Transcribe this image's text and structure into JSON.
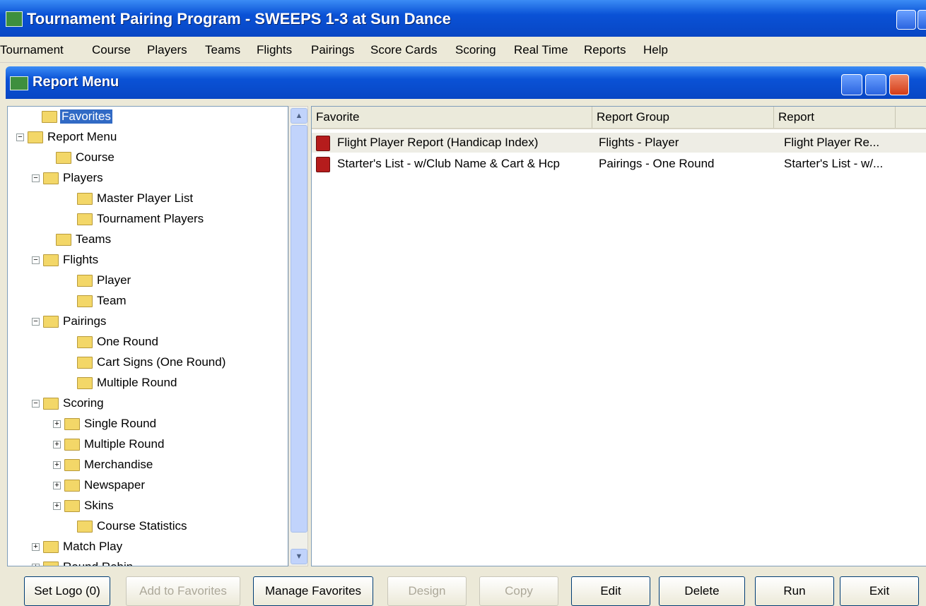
{
  "app": {
    "title": "Tournament Pairing Program - SWEEPS 1-3 at Sun Dance"
  },
  "menu": [
    "Tournament",
    "Course",
    "Players",
    "Teams",
    "Flights",
    "Pairings",
    "Score Cards",
    "Scoring",
    "Real Time",
    "Reports",
    "Help"
  ],
  "window": {
    "title": "Report Menu"
  },
  "tree": [
    {
      "label": "Favorites",
      "selected": true
    },
    {
      "label": "Report Menu",
      "expander": "−"
    },
    {
      "label": "Course"
    },
    {
      "label": "Players",
      "expander": "−"
    },
    {
      "label": "Master Player List"
    },
    {
      "label": "Tournament Players"
    },
    {
      "label": "Teams"
    },
    {
      "label": "Flights",
      "expander": "−"
    },
    {
      "label": "Player"
    },
    {
      "label": "Team"
    },
    {
      "label": "Pairings",
      "expander": "−"
    },
    {
      "label": "One Round"
    },
    {
      "label": "Cart Signs (One Round)"
    },
    {
      "label": "Multiple Round"
    },
    {
      "label": "Scoring",
      "expander": "−"
    },
    {
      "label": "Single Round",
      "expander": "+"
    },
    {
      "label": "Multiple Round",
      "expander": "+"
    },
    {
      "label": "Merchandise",
      "expander": "+"
    },
    {
      "label": "Newspaper",
      "expander": "+"
    },
    {
      "label": "Skins",
      "expander": "+"
    },
    {
      "label": "Course Statistics"
    },
    {
      "label": "Match Play",
      "expander": "+"
    },
    {
      "label": "Round Robin",
      "expander": "+"
    }
  ],
  "list": {
    "columns": [
      "Favorite",
      "Report Group",
      "Report"
    ],
    "rows": [
      {
        "favorite": "Flight Player Report (Handicap Index)",
        "group": "Flights - Player",
        "report": "Flight Player Re..."
      },
      {
        "favorite": "Starter's List - w/Club Name & Cart & Hcp",
        "group": "Pairings - One Round",
        "report": "Starter's List - w/..."
      }
    ]
  },
  "buttons": {
    "set_logo": "Set Logo (0)",
    "add_fav": "Add to Favorites",
    "manage_fav": "Manage Favorites",
    "design": "Design",
    "copy": "Copy",
    "edit": "Edit",
    "delete": "Delete",
    "run": "Run",
    "exit": "Exit"
  }
}
